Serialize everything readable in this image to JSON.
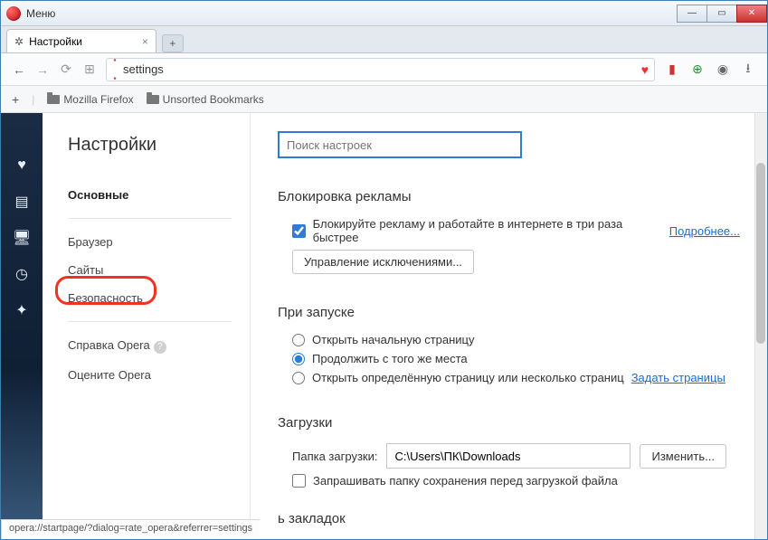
{
  "titlebar": {
    "menu": "Меню"
  },
  "tabs": {
    "active": {
      "label": "Настройки"
    }
  },
  "address": {
    "url": "settings"
  },
  "bookmarks": {
    "items": [
      "Mozilla Firefox",
      "Unsorted Bookmarks"
    ]
  },
  "nav": {
    "title": "Настройки",
    "main_cat": "Основные",
    "items": [
      "Браузер",
      "Сайты",
      "Безопасность"
    ],
    "help": "Справка Opera",
    "rate": "Оцените Opera"
  },
  "content": {
    "search_placeholder": "Поиск настроек",
    "adblock": {
      "heading": "Блокировка рекламы",
      "checkbox_label": "Блокируйте рекламу и работайте в интернете в три раза быстрее",
      "learn_more": "Подробнее...",
      "manage_btn": "Управление исключениями..."
    },
    "startup": {
      "heading": "При запуске",
      "opt1": "Открыть начальную страницу",
      "opt2": "Продолжить с того же места",
      "opt3": "Открыть определённую страницу или несколько страниц",
      "set_pages": "Задать страницы"
    },
    "downloads": {
      "heading": "Загрузки",
      "folder_label": "Папка загрузки:",
      "folder_value": "C:\\Users\\ПК\\Downloads",
      "change_btn": "Изменить...",
      "ask_label": "Запрашивать папку сохранения перед загрузкой файла"
    },
    "bookmarks_bar_heading": "ь закладок"
  },
  "status_text": "opera://startpage/?dialog=rate_opera&referrer=settings"
}
